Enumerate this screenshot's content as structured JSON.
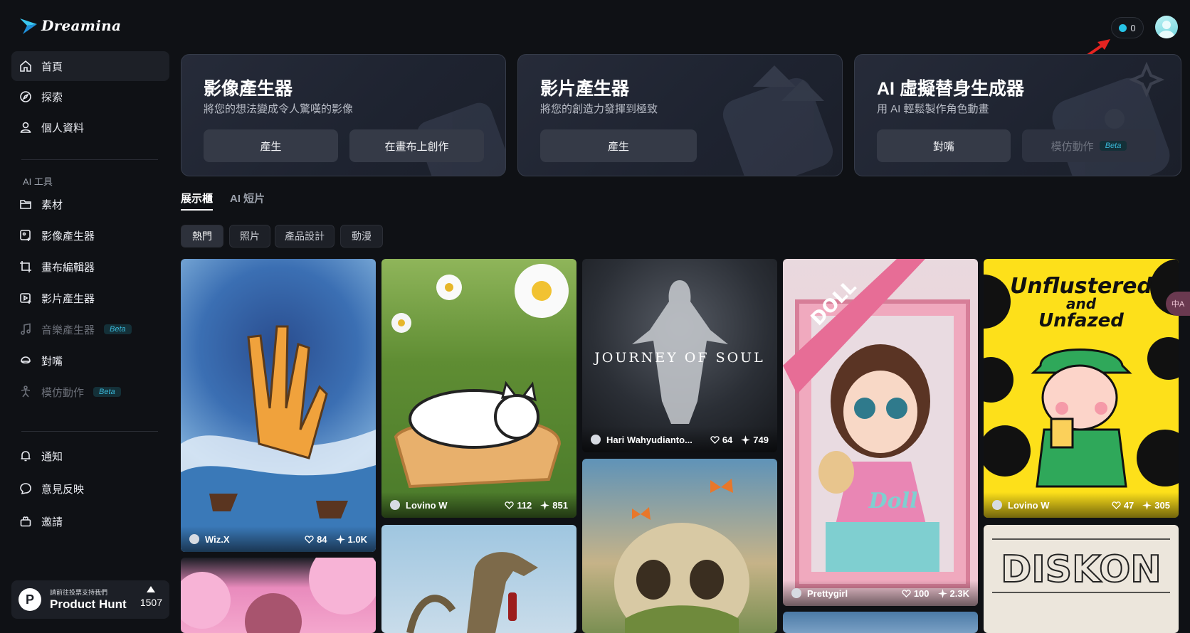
{
  "app": {
    "name": "Dreamina"
  },
  "sidebar": {
    "nav": [
      {
        "label": "首頁",
        "icon": "home-icon"
      },
      {
        "label": "探索",
        "icon": "compass-icon"
      },
      {
        "label": "個人資料",
        "icon": "user-icon"
      }
    ],
    "section_label": "AI 工具",
    "tools": [
      {
        "label": "素材",
        "icon": "folder-icon"
      },
      {
        "label": "影像產生器",
        "icon": "image-plus-icon"
      },
      {
        "label": "畫布編輯器",
        "icon": "crop-icon"
      },
      {
        "label": "影片產生器",
        "icon": "video-plus-icon"
      },
      {
        "label": "音樂產生器",
        "icon": "music-icon",
        "badge": "Beta"
      },
      {
        "label": "對嘴",
        "icon": "lipsync-icon"
      },
      {
        "label": "模仿動作",
        "icon": "motion-icon",
        "badge": "Beta"
      }
    ],
    "bottom": [
      {
        "label": "通知",
        "icon": "bell-icon"
      },
      {
        "label": "意見反映",
        "icon": "feedback-icon"
      },
      {
        "label": "邀請",
        "icon": "gift-icon"
      }
    ],
    "product_hunt": {
      "small": "請前往投票支持我們",
      "big": "Product Hunt",
      "votes": "1507",
      "logo": "P"
    }
  },
  "header": {
    "credits": "0"
  },
  "cards": [
    {
      "title": "影像產生器",
      "subtitle": "將您的想法變成令人驚嘆的影像",
      "buttons": [
        "產生",
        "在畫布上創作"
      ]
    },
    {
      "title": "影片產生器",
      "subtitle": "將您的創造力發揮到極致",
      "buttons": [
        "產生"
      ]
    },
    {
      "title": "AI 虛擬替身生成器",
      "subtitle": "用 AI 輕鬆製作角色動畫",
      "buttons": [
        "對嘴",
        "模仿動作"
      ],
      "beta": "Beta"
    }
  ],
  "tabs": [
    "展示櫃",
    "AI 短片"
  ],
  "filters": [
    "熱門",
    "照片",
    "產品設計",
    "動漫"
  ],
  "gallery": [
    {
      "author": "Wiz.X",
      "likes": "84",
      "uses": "1.0K"
    },
    {
      "author": "Lovino W",
      "likes": "112",
      "uses": "851"
    },
    {
      "author": "Hari Wahyudianto...",
      "likes": "64",
      "uses": "749",
      "image_text": "JOURNEY OF SOUL"
    },
    {
      "author": "Prettygirl",
      "likes": "100",
      "uses": "2.3K",
      "image_text": [
        "DOLL",
        "Doll"
      ]
    },
    {
      "author": "Lovino W",
      "likes": "47",
      "uses": "305",
      "image_text": [
        "Unflustered",
        "and",
        "Unfazed"
      ]
    },
    {
      "image_text": "DISKON"
    }
  ],
  "translate": "中A",
  "colors": {
    "accent": "#27c3e6",
    "beta": "#39b6d6",
    "arrow": "#e52421"
  }
}
